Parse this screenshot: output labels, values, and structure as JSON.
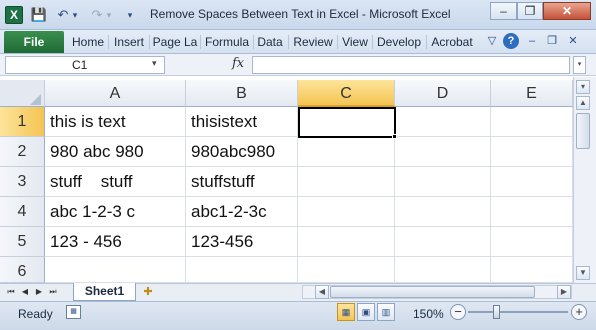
{
  "window": {
    "title": "Remove Spaces Between Text in Excel  -  Microsoft Excel",
    "app_icon": "excel-logo",
    "app_icon_letter": "X",
    "qat": {
      "save_icon": "💾",
      "undo_icon": "↶",
      "undo_drop": "▾",
      "redo_icon": "↷",
      "redo_drop": "▾",
      "customize": "▾"
    },
    "controls": {
      "minimize": "–",
      "restore": "❐",
      "close": "✕"
    }
  },
  "ribbon": {
    "file_label": "File",
    "tabs": [
      "Home",
      "Insert",
      "Page La",
      "Formula",
      "Data",
      "Review",
      "View",
      "Develop",
      "Acrobat"
    ],
    "icons": {
      "collapse": "▽",
      "help": "?",
      "minimize": "–",
      "restore": "❐",
      "close": "✕"
    }
  },
  "formula_bar": {
    "name_box": "C1",
    "name_box_arrow": "▾",
    "fx": "fx",
    "formula_value": "",
    "expand": "▾"
  },
  "sheet": {
    "columns": [
      "A",
      "B",
      "C",
      "D",
      "E"
    ],
    "active_column": "C",
    "active_row": "1",
    "rows": [
      {
        "num": "1",
        "cells": [
          "this is text",
          "thisistext",
          "",
          "",
          ""
        ]
      },
      {
        "num": "2",
        "cells": [
          "980 abc 980",
          "980abc980",
          "",
          "",
          ""
        ]
      },
      {
        "num": "3",
        "cells": [
          "stuff    stuff",
          "stuffstuff",
          "",
          "",
          ""
        ]
      },
      {
        "num": "4",
        "cells": [
          "abc 1-2-3 c",
          "abc1-2-3c",
          "",
          "",
          ""
        ]
      },
      {
        "num": "5",
        "cells": [
          "123 - 456",
          "123-456",
          "",
          "",
          ""
        ]
      },
      {
        "num": "6",
        "cells": [
          "",
          "",
          "",
          "",
          ""
        ]
      }
    ]
  },
  "tabs_bar": {
    "nav": [
      "⏮",
      "◀",
      "▶",
      "⏭"
    ],
    "sheet_tab": "Sheet1",
    "new_sheet_icon": "✚"
  },
  "status_bar": {
    "ready": "Ready",
    "macro_icon": "▦",
    "view_icons": [
      "▦",
      "▣",
      "▥"
    ],
    "zoom": "150%",
    "zoom_minus": "−",
    "zoom_plus": "+",
    "zoom_level_fraction": 0.6
  },
  "colors": {
    "active_header": "#f4c453",
    "file_tab": "#1e6b34",
    "ribbon": "#d5e1f0"
  }
}
